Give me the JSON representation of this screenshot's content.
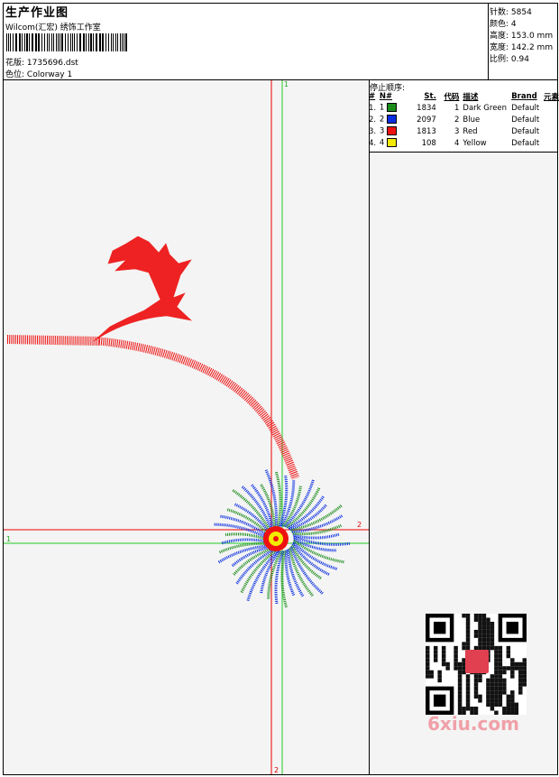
{
  "header": {
    "title": "生产作业图",
    "company": "Wilcom(汇宏) 绣饰工作室",
    "design_label": "花版:",
    "design_file": "1735696.dst",
    "colorway_label": "色位:",
    "colorway": "Colorway 1"
  },
  "stats": {
    "stitches_label": "针数:",
    "stitches": "5854",
    "colors_label": "颜色:",
    "colors": "4",
    "height_label": "高度:",
    "height": "153.0 mm",
    "width_label": "宽度:",
    "width": "142.2 mm",
    "scale_label": "比例:",
    "scale": "0.94"
  },
  "legend": {
    "title": "停止顺序:",
    "columns": [
      "#",
      "N#",
      "St.",
      "代码",
      "描述",
      "Brand",
      "元素"
    ],
    "rows": [
      {
        "num": "1.",
        "n": "1",
        "color": "#1a8c1a",
        "st": "1834",
        "code": "1",
        "desc": "Dark Green",
        "brand": "Default"
      },
      {
        "num": "2.",
        "n": "2",
        "color": "#0a2ee0",
        "st": "2097",
        "code": "2",
        "desc": "Blue",
        "brand": "Default"
      },
      {
        "num": "3.",
        "n": "3",
        "color": "#ee1111",
        "st": "1813",
        "code": "3",
        "desc": "Red",
        "brand": "Default"
      },
      {
        "num": "4.",
        "n": "4",
        "color": "#f2ea00",
        "st": "108",
        "code": "4",
        "desc": "Yellow",
        "brand": "Default"
      }
    ]
  },
  "canvas": {
    "axis_labels": [
      "1",
      "2",
      "1",
      "2"
    ]
  },
  "watermark": {
    "text": "6xiu.com"
  }
}
